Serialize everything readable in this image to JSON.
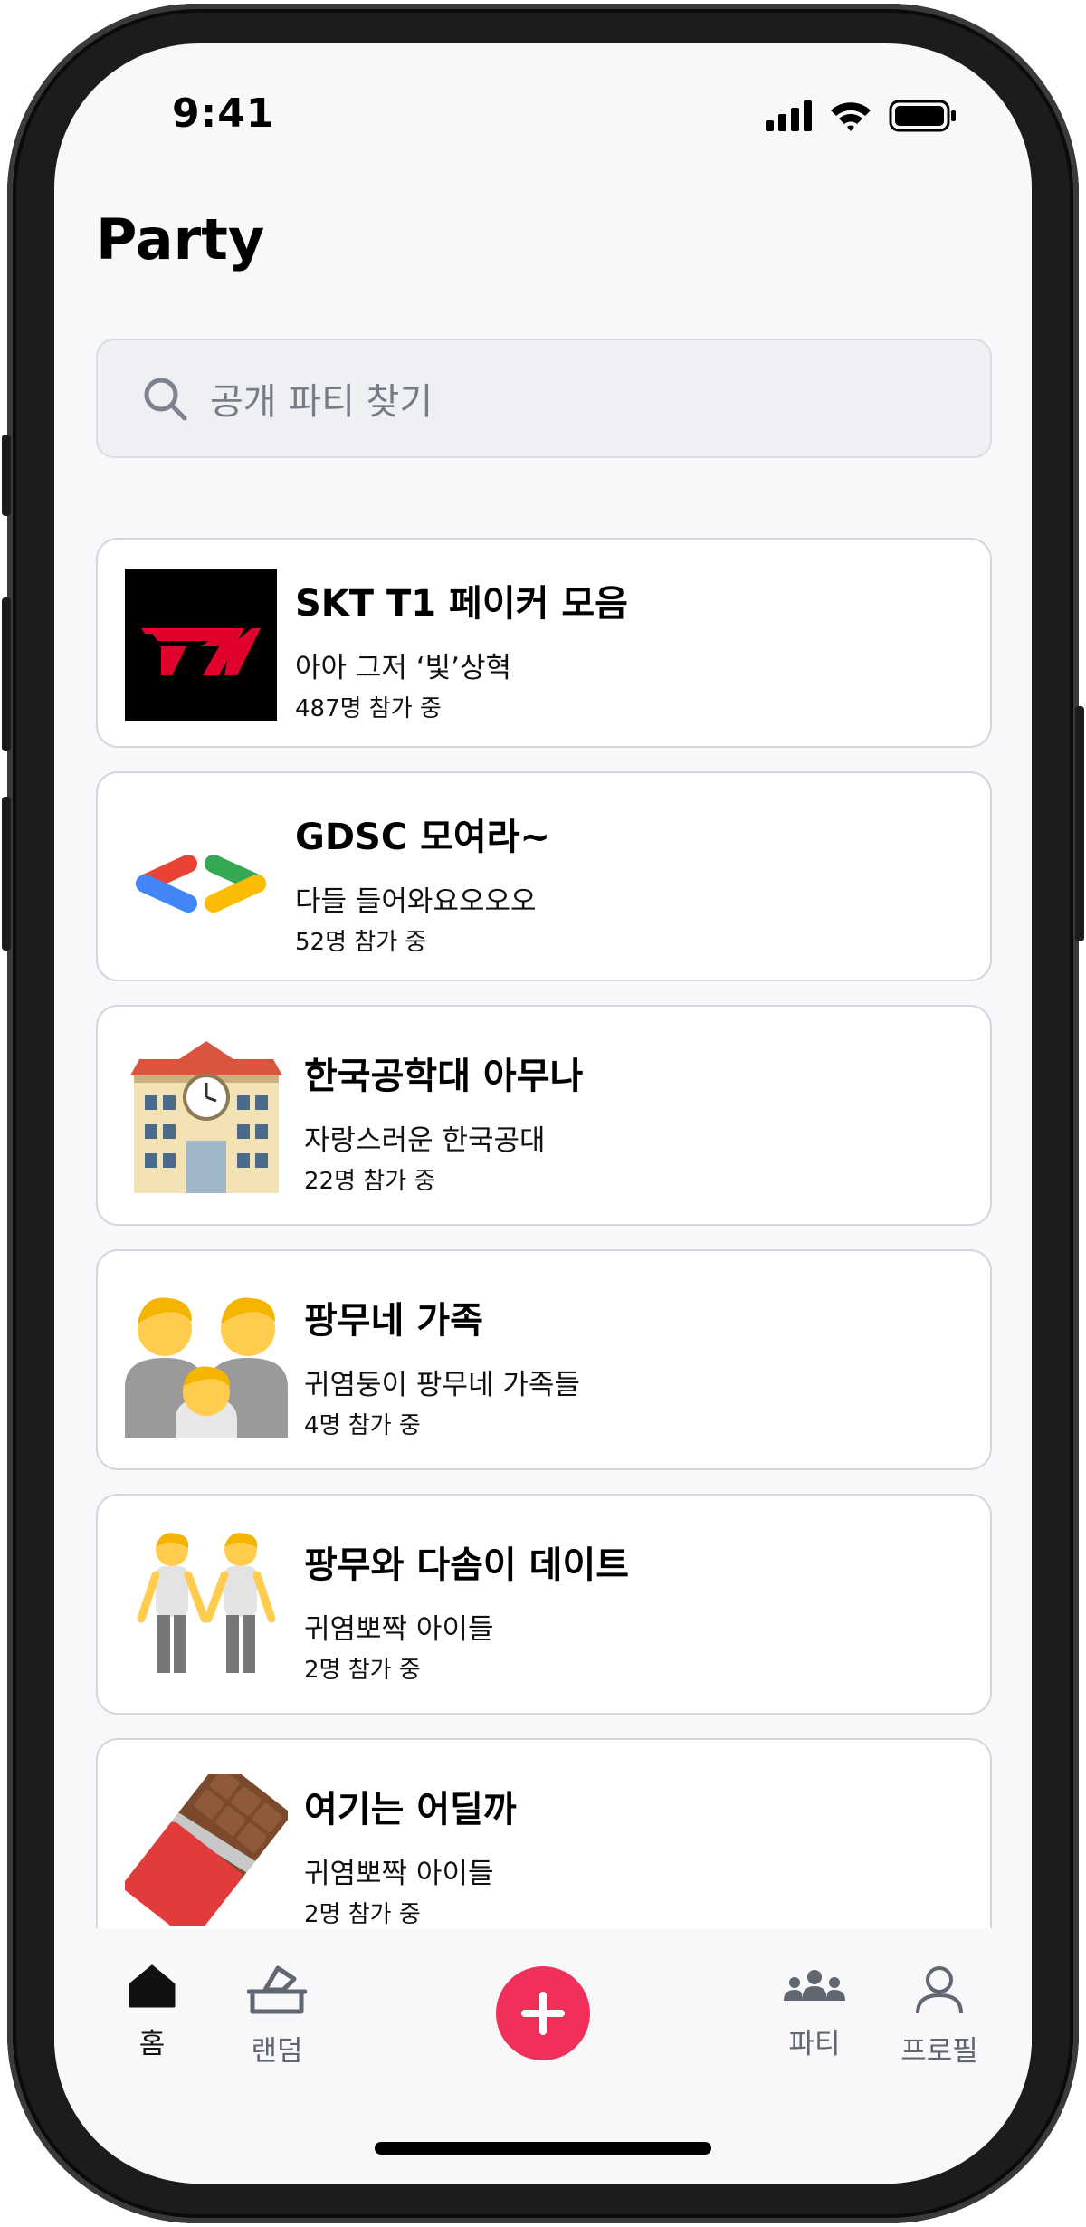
{
  "status": {
    "time": "9:41"
  },
  "header": {
    "title": "Party"
  },
  "search": {
    "placeholder": "공개 파티 찾기"
  },
  "parties": [
    {
      "title": "SKT T1 페이커 모음",
      "description": "아아 그저 ‘빛’상혁",
      "count": "487명 참가 중",
      "thumb_icon": "t1-logo-icon"
    },
    {
      "title": "GDSC 모여라~",
      "description": "다들 들어와요오오오",
      "count": "52명 참가 중",
      "thumb_icon": "gdsc-logo-icon"
    },
    {
      "title": "한국공학대 아무나",
      "description": "자랑스러운 한국공대",
      "count": "22명 참가 중",
      "thumb_icon": "school-building-icon"
    },
    {
      "title": "팡무네 가족",
      "description": "귀염둥이 팡무네 가족들",
      "count": "4명 참가 중",
      "thumb_icon": "family-icon"
    },
    {
      "title": "팡무와 다솜이 데이트",
      "description": "귀염뽀짝 아이들",
      "count": "2명 참가 중",
      "thumb_icon": "holding-hands-icon"
    },
    {
      "title": "여기는 어딜까",
      "description": "귀염뽀짝 아이들",
      "count": "2명 참가 중",
      "thumb_icon": "chocolate-bar-icon"
    }
  ],
  "tabbar": {
    "home": "홈",
    "random": "랜덤",
    "party": "파티",
    "profile": "프로필",
    "add_icon": "plus-icon"
  },
  "colors": {
    "accent": "#f0305a",
    "t1_red": "#e2012d",
    "background": "#f8f8fa"
  }
}
